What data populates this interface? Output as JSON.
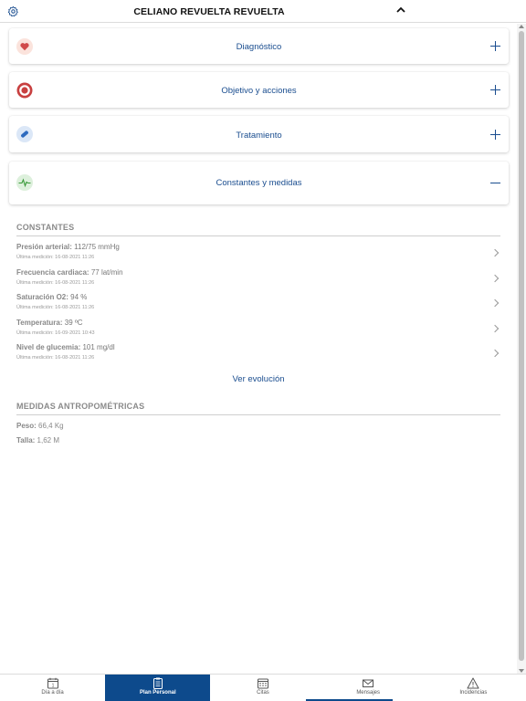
{
  "header": {
    "title": "CELIANO REVUELTA REVUELTA"
  },
  "accordion": [
    {
      "label": "Diagnóstico",
      "icon": "heart-icon",
      "icon_bg": "#fbe3dc",
      "icon_color": "#d04a4a",
      "expanded": false
    },
    {
      "label": "Objetivo y acciones",
      "icon": "target-icon",
      "icon_bg": "#fbe3dc",
      "icon_color": "#c84040",
      "expanded": false
    },
    {
      "label": "Tratamiento",
      "icon": "pill-icon",
      "icon_bg": "#dbe7f7",
      "icon_color": "#2e6bbf",
      "expanded": false
    },
    {
      "label": "Constantes y medidas",
      "icon": "pulse-icon",
      "icon_bg": "#ddf0dc",
      "icon_color": "#3a9a3a",
      "expanded": true
    }
  ],
  "constantes": {
    "title": "CONSTANTES",
    "items": [
      {
        "key": "Presión arterial:",
        "value": " 112/75 mmHg",
        "date": "Última medición: 16-08-2021 11:26"
      },
      {
        "key": "Frecuencia cardiaca:",
        "value": " 77 lat/min",
        "date": "Última medición: 16-08-2021 11:26"
      },
      {
        "key": "Saturación O2:",
        "value": " 94 %",
        "date": "Última medición: 16-08-2021 11:26"
      },
      {
        "key": "Temperatura:",
        "value": " 39 ºC",
        "date": "Última medición: 16-09-2021 10:43"
      },
      {
        "key": "Nivel de glucemia:",
        "value": " 101 mg/dl",
        "date": "Última medición: 16-08-2021 11:26"
      }
    ],
    "link": "Ver evolución"
  },
  "medidas": {
    "title": "MEDIDAS ANTROPOMÉTRICAS",
    "items": [
      {
        "key": "Peso:",
        "value": " 66,4 Kg"
      },
      {
        "key": "Talla:",
        "value": " 1,62 M"
      }
    ]
  },
  "nav": [
    {
      "label": "Día a día",
      "icon": "calendar-day-icon",
      "active": false
    },
    {
      "label": "Plan Personal",
      "icon": "clipboard-icon",
      "active": true
    },
    {
      "label": "Citas",
      "icon": "calendar-grid-icon",
      "active": false
    },
    {
      "label": "Mensajes",
      "icon": "envelope-icon",
      "active": false
    },
    {
      "label": "Incidencias",
      "icon": "warning-icon",
      "active": false
    }
  ],
  "colors": {
    "accent": "#1a4d8f",
    "nav_active": "#0d4a8c"
  }
}
